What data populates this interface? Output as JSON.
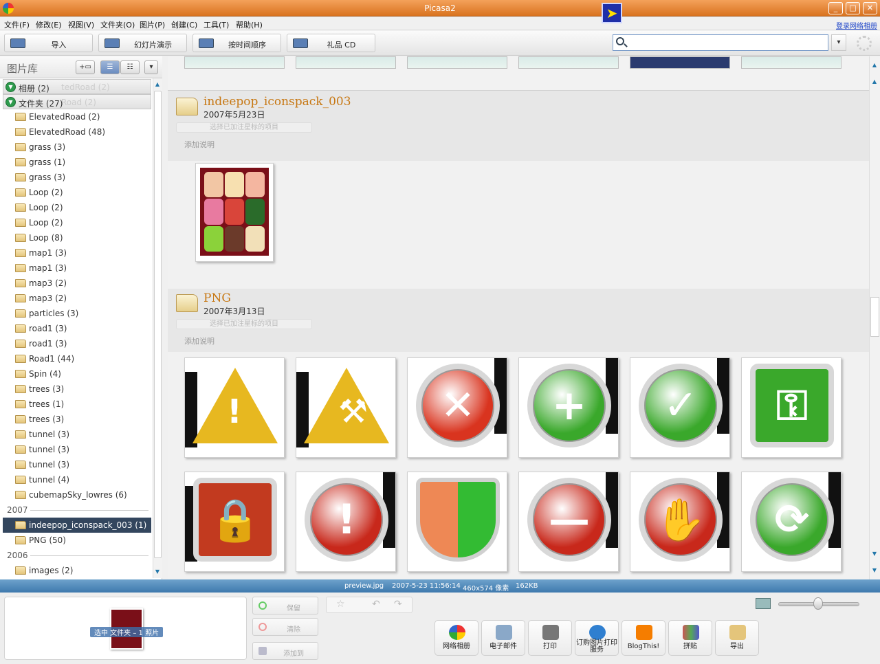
{
  "window": {
    "title": "Picasa2",
    "controls": [
      "_",
      "□",
      "✕"
    ]
  },
  "menu": {
    "items": [
      "文件(F)",
      "修改(E)",
      "视图(V)",
      "文件夹(O)",
      "图片(P)",
      "创建(C)",
      "工具(T)",
      "帮助(H)"
    ],
    "sign_in": "登录网络相册"
  },
  "toolbar": {
    "import": "导入",
    "slideshow": "幻灯片演示",
    "timeline": "按时间顺序",
    "giftcd": "礼品 CD"
  },
  "search": {
    "value": "",
    "placeholder": ""
  },
  "library": {
    "title": "图片库",
    "albums_label": "相册 (2)",
    "albums_ghost": "tedRoad (2)",
    "folders_label": "文件夹 (27)",
    "folders_ghost": "Road (2)",
    "folders": [
      "ElevatedRoad (2)",
      "ElevatedRoad (48)",
      "grass (3)",
      "grass (1)",
      "grass (3)",
      "Loop (2)",
      "Loop (2)",
      "Loop (2)",
      "Loop (8)",
      "map1 (3)",
      "map1 (3)",
      "map3 (2)",
      "map3 (2)",
      "particles (3)",
      "road1 (3)",
      "road1 (3)",
      "Road1 (44)",
      "Spin (4)",
      "trees (3)",
      "trees (1)",
      "trees (3)",
      "tunnel (3)",
      "tunnel (3)",
      "tunnel (3)",
      "tunnel (4)",
      "cubemapSky_lowres (6)"
    ],
    "year_2007": "2007",
    "folders_2007": [
      "indeepop_iconspack_003 (1)",
      "PNG (50)"
    ],
    "year_2006": "2006",
    "folders_2006": [
      "images (2)"
    ]
  },
  "main": {
    "folder1": {
      "title": "indeepop_iconspack_003",
      "date": "2007年5月23日",
      "star_filter": "选择已加注星标的项目",
      "caption": "添加说明"
    },
    "folder2": {
      "title": "PNG",
      "date": "2007年3月13日",
      "star_filter": "选择已加注星标的项目",
      "caption": "添加说明"
    },
    "icons": [
      "warning-icon",
      "construction-icon",
      "error-icon",
      "add-icon",
      "check-icon",
      "key-icon",
      "lock-icon",
      "alert-icon",
      "shield-icon",
      "remove-icon",
      "stop-hand-icon",
      "refresh-icon"
    ],
    "icon_symbols": [
      "!",
      "⚒",
      "✕",
      "+",
      "✓",
      "⚿",
      "🔒",
      "!",
      "",
      "—",
      "✋",
      "⟳"
    ],
    "icon_colors": [
      "#e7b820",
      "#e7b820",
      "#d9341f",
      "#3aa82b",
      "#3aa82b",
      "#3aa82b",
      "#c23a1f",
      "#c8281b",
      "#e85",
      "#c8281b",
      "#c8281b",
      "#3aa82b"
    ]
  },
  "status": {
    "filename": "preview.jpg",
    "datetime": "2007-5-23 11:56:14",
    "dimensions": "460x574 像素",
    "size": "162KB"
  },
  "tray": {
    "label": "选中 文件夹 – 1 照片",
    "hold": "保留",
    "clear": "清除",
    "add_to": "添加到"
  },
  "actions": {
    "web_album": "网络相册",
    "email": "电子邮件",
    "print": "打印",
    "order_prints": "订购图片打印服务",
    "blog": "BlogThis!",
    "collage": "拼贴",
    "export": "导出"
  }
}
